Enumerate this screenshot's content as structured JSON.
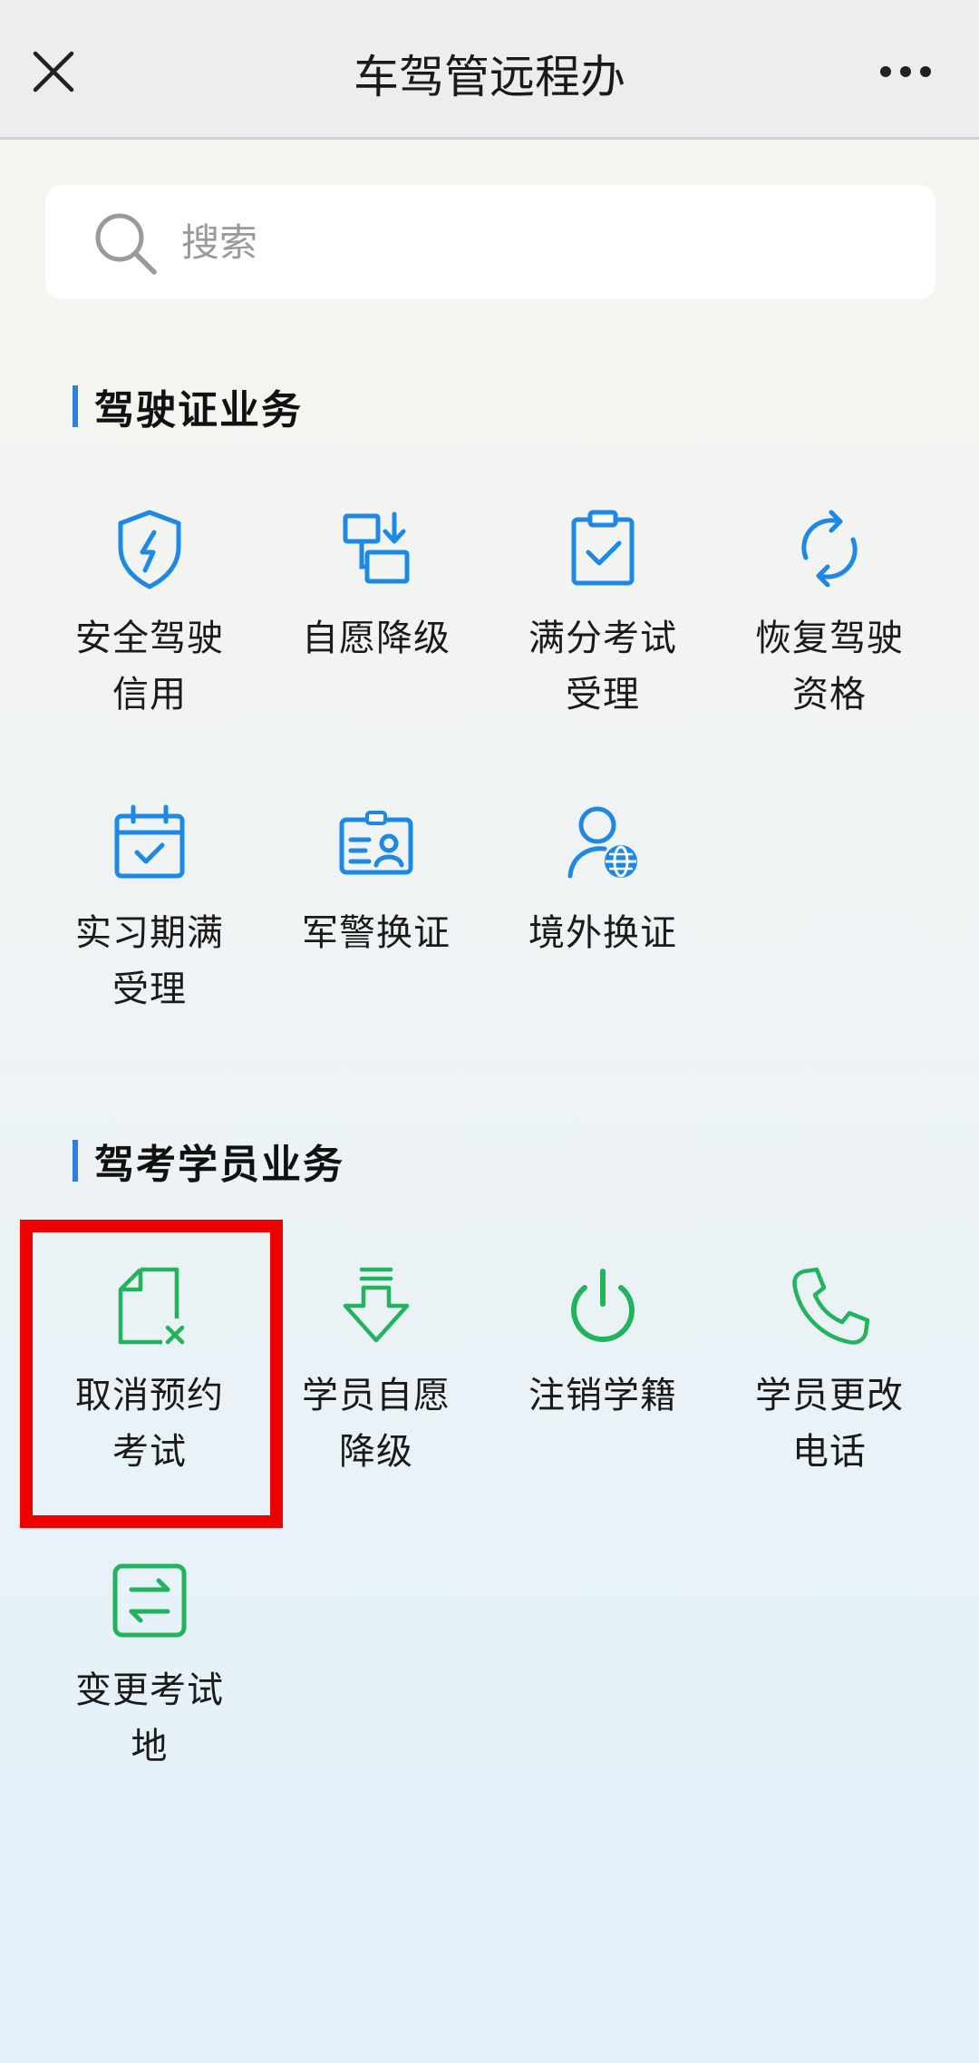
{
  "header": {
    "title": "车驾管远程办",
    "close_icon": "close-icon",
    "more_icon": "more-dots-icon"
  },
  "search": {
    "placeholder": "搜索",
    "value": "",
    "icon": "search-icon"
  },
  "sections": [
    {
      "title": "驾驶证业务",
      "accent_color": "#2f7fe0",
      "items": [
        {
          "label": "安全驾驶\n信用",
          "icon": "shield-icon",
          "color": "#1e88e5"
        },
        {
          "label": "自愿降级",
          "icon": "downgrade-icon",
          "color": "#1e88e5"
        },
        {
          "label": "满分考试\n受理",
          "icon": "clipboard-check-icon",
          "color": "#1e88e5"
        },
        {
          "label": "恢复驾驶\n资格",
          "icon": "refresh-icon",
          "color": "#1e88e5"
        },
        {
          "label": "实习期满\n受理",
          "icon": "calendar-check-icon",
          "color": "#1e88e5"
        },
        {
          "label": "军警换证",
          "icon": "id-card-icon",
          "color": "#1e88e5"
        },
        {
          "label": "境外换证",
          "icon": "user-globe-icon",
          "color": "#1e88e5"
        }
      ]
    },
    {
      "title": "驾考学员业务",
      "accent_color": "#2f7fe0",
      "items": [
        {
          "label": "取消预约\n考试",
          "icon": "cancel-document-icon",
          "color": "#21b45c"
        },
        {
          "label": "学员自愿\n降级",
          "icon": "download-arrow-icon",
          "color": "#21b45c"
        },
        {
          "label": "注销学籍",
          "icon": "power-icon",
          "color": "#21b45c"
        },
        {
          "label": "学员更改\n电话",
          "icon": "phone-icon",
          "color": "#21b45c"
        },
        {
          "label": "变更考试\n地",
          "icon": "swap-arrows-icon",
          "color": "#21b45c"
        }
      ]
    }
  ],
  "highlight_color": "#ee0000"
}
